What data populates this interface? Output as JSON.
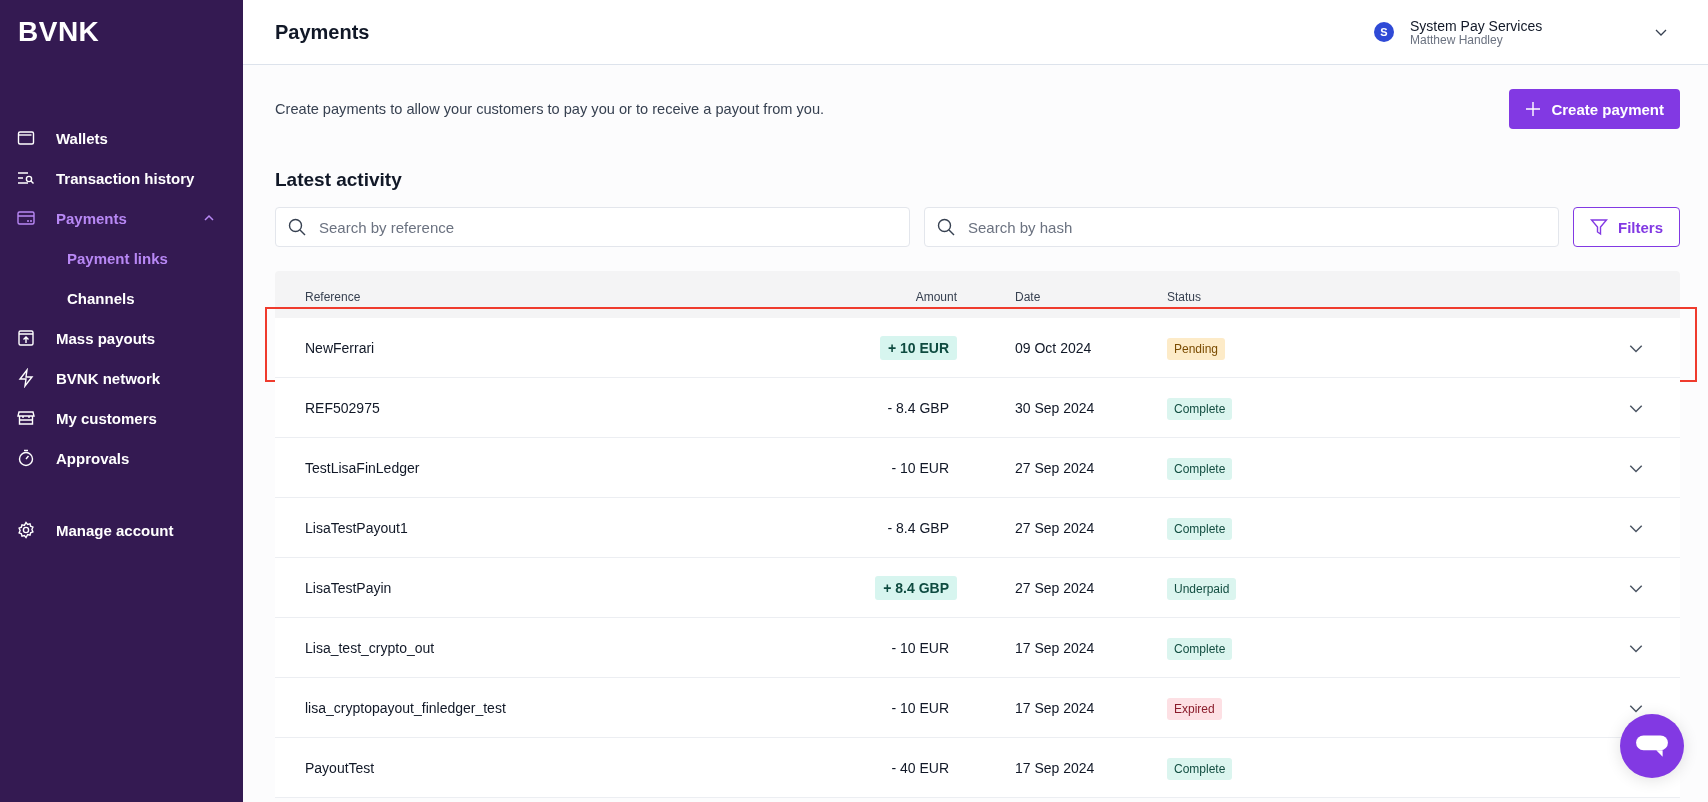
{
  "sidebar": {
    "logo": "BVNK",
    "items": [
      {
        "label": "Wallets",
        "selected": false
      },
      {
        "label": "Transaction history",
        "selected": false
      },
      {
        "label": "Payments",
        "selected": true,
        "expanded": true,
        "children": [
          {
            "label": "Payment links",
            "selected": true
          },
          {
            "label": "Channels",
            "selected": false
          }
        ]
      },
      {
        "label": "Mass payouts",
        "selected": false
      },
      {
        "label": "BVNK network",
        "selected": false
      },
      {
        "label": "My customers",
        "selected": false
      },
      {
        "label": "Approvals",
        "selected": false
      }
    ],
    "footer_item": {
      "label": "Manage account",
      "selected": false
    }
  },
  "header": {
    "title": "Payments",
    "account": {
      "avatar": "S",
      "name": "System Pay Services",
      "user": "Matthew Handley"
    }
  },
  "intro": "Create payments to allow your customers to pay you or to receive a payout from you.",
  "create_button": "Create payment",
  "section_title": "Latest activity",
  "search_reference": {
    "placeholder": "Search by reference"
  },
  "search_hash": {
    "placeholder": "Search by hash"
  },
  "filters_button": "Filters",
  "table": {
    "columns": [
      "Reference",
      "Amount",
      "Date",
      "Status"
    ],
    "rows": [
      {
        "reference": "NewFerrari",
        "amount": {
          "text": "+ 10 EUR",
          "kind": "credit"
        },
        "date": "09 Oct 2024",
        "status": {
          "label": "Pending",
          "kind": "pending"
        },
        "highlighted": true
      },
      {
        "reference": "REF502975",
        "amount": {
          "text": "- 8.4 GBP",
          "kind": "debit"
        },
        "date": "30 Sep 2024",
        "status": {
          "label": "Complete",
          "kind": "complete"
        },
        "highlighted": false
      },
      {
        "reference": "TestLisaFinLedger",
        "amount": {
          "text": "- 10 EUR",
          "kind": "debit"
        },
        "date": "27 Sep 2024",
        "status": {
          "label": "Complete",
          "kind": "complete"
        },
        "highlighted": false
      },
      {
        "reference": "LisaTestPayout1",
        "amount": {
          "text": "- 8.4 GBP",
          "kind": "debit"
        },
        "date": "27 Sep 2024",
        "status": {
          "label": "Complete",
          "kind": "complete"
        },
        "highlighted": false
      },
      {
        "reference": "LisaTestPayin",
        "amount": {
          "text": "+ 8.4 GBP",
          "kind": "credit"
        },
        "date": "27 Sep 2024",
        "status": {
          "label": "Underpaid",
          "kind": "underpaid"
        },
        "highlighted": false
      },
      {
        "reference": "Lisa_test_crypto_out",
        "amount": {
          "text": "- 10 EUR",
          "kind": "debit"
        },
        "date": "17 Sep 2024",
        "status": {
          "label": "Complete",
          "kind": "complete"
        },
        "highlighted": false
      },
      {
        "reference": "lisa_cryptopayout_finledger_test",
        "amount": {
          "text": "- 10 EUR",
          "kind": "debit"
        },
        "date": "17 Sep 2024",
        "status": {
          "label": "Expired",
          "kind": "expired"
        },
        "highlighted": false
      },
      {
        "reference": "PayoutTest",
        "amount": {
          "text": "- 40 EUR",
          "kind": "debit"
        },
        "date": "17 Sep 2024",
        "status": {
          "label": "Complete",
          "kind": "complete"
        },
        "highlighted": false
      }
    ]
  }
}
